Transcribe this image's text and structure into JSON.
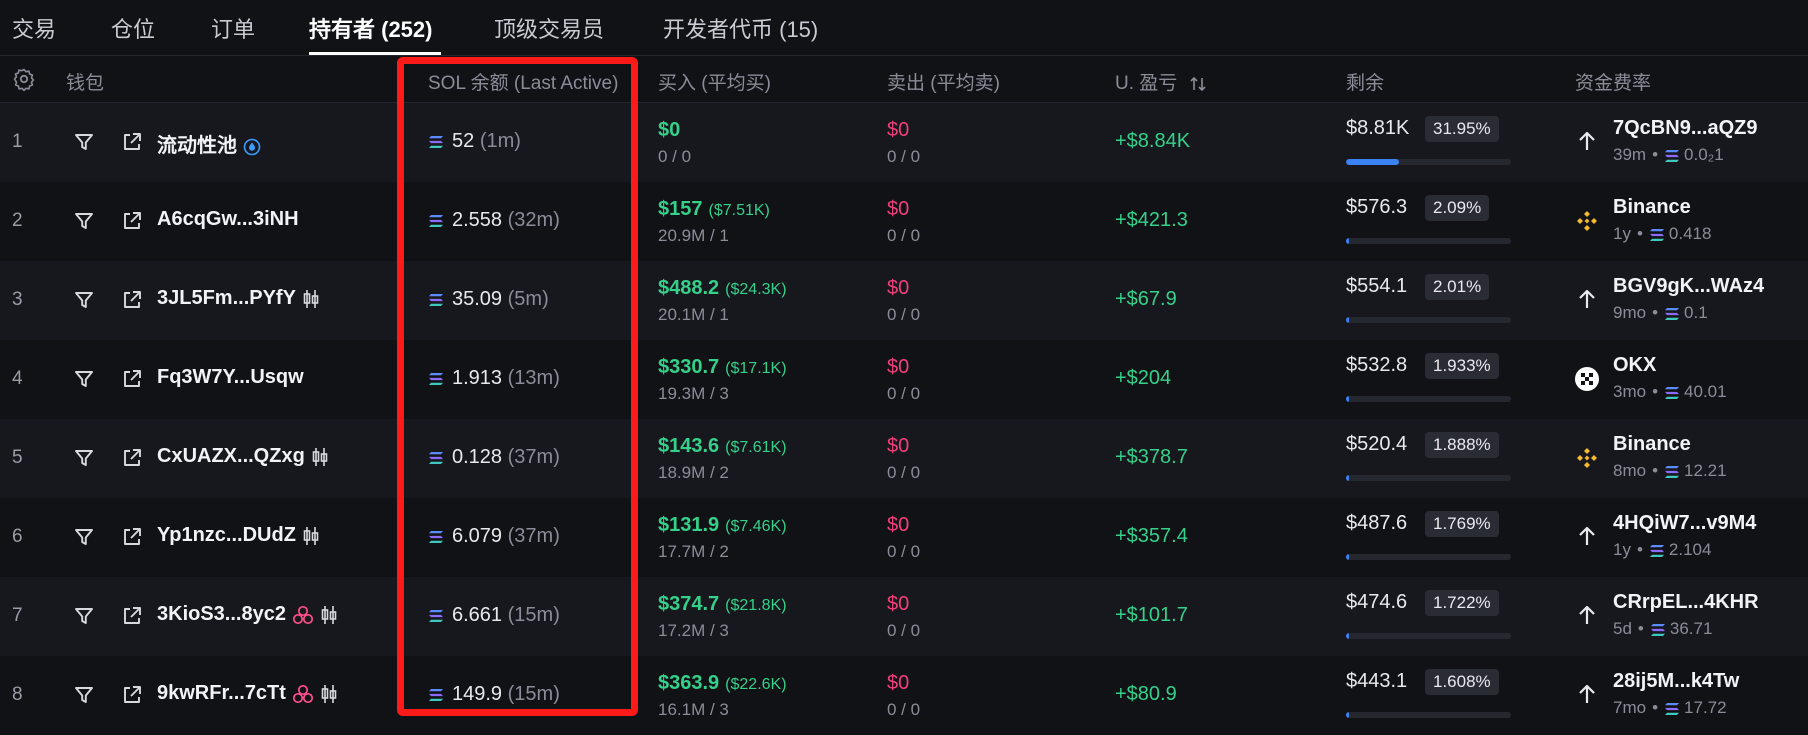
{
  "tabs": [
    "交易",
    "仓位",
    "订单",
    "持有者 (252)",
    "顶级交易员",
    "开发者代币 (15)"
  ],
  "active_tab_index": 3,
  "columns": {
    "wallet": "钱包",
    "sol_balance": "SOL 余额 (Last Active)",
    "buy": "买入 (平均买)",
    "sell": "卖出 (平均卖)",
    "pnl": "U. 盈亏",
    "remaining": "剩余",
    "funding": "资金费率"
  },
  "icons": {
    "settings": "gear-icon",
    "filter": "filter-icon",
    "external": "external-link-icon",
    "sol": "solana-icon",
    "sort": "sort-icon",
    "arrow_up": "arrow-up-icon",
    "binance": "binance-icon",
    "okx": "okx-icon"
  },
  "colors": {
    "positive": "#35d08a",
    "negative": "#f0407a",
    "accent_bar": "#3b82f6",
    "highlight": "#ff1a1a"
  },
  "rows": [
    {
      "index": "1",
      "wallet": "流动性池",
      "tags": [
        "pool"
      ],
      "sol": "52",
      "last_active": "(1m)",
      "buy": "$0",
      "buy_avg": "",
      "buy_sub": "0 / 0",
      "sell": "$0",
      "sell_sub": "0 / 0",
      "pnl": "+$8.84K",
      "remaining": "$8.81K",
      "pct": "31.95%",
      "pct_value": 0.3195,
      "fund_icon": "arrow-up",
      "fund_name": "7QcBN9...aQZ9",
      "fund_age": "39m",
      "fund_sol": "0.0₂1"
    },
    {
      "index": "2",
      "wallet": "A6cqGw...3iNH",
      "tags": [],
      "sol": "2.558",
      "last_active": "(32m)",
      "buy": "$157",
      "buy_avg": "($7.51K)",
      "buy_sub": "20.9M / 1",
      "sell": "$0",
      "sell_sub": "0 / 0",
      "pnl": "+$421.3",
      "remaining": "$576.3",
      "pct": "2.09%",
      "pct_value": 0.0209,
      "fund_icon": "binance",
      "fund_name": "Binance",
      "fund_age": "1y",
      "fund_sol": "0.418"
    },
    {
      "index": "3",
      "wallet": "3JL5Fm...PYfY",
      "tags": [
        "candle"
      ],
      "sol": "35.09",
      "last_active": "(5m)",
      "buy": "$488.2",
      "buy_avg": "($24.3K)",
      "buy_sub": "20.1M / 1",
      "sell": "$0",
      "sell_sub": "0 / 0",
      "pnl": "+$67.9",
      "remaining": "$554.1",
      "pct": "2.01%",
      "pct_value": 0.0201,
      "fund_icon": "arrow-up",
      "fund_name": "BGV9gK...WAz4",
      "fund_age": "9mo",
      "fund_sol": "0.1"
    },
    {
      "index": "4",
      "wallet": "Fq3W7Y...Usqw",
      "tags": [],
      "sol": "1.913",
      "last_active": "(13m)",
      "buy": "$330.7",
      "buy_avg": "($17.1K)",
      "buy_sub": "19.3M / 3",
      "sell": "$0",
      "sell_sub": "0 / 0",
      "pnl": "+$204",
      "remaining": "$532.8",
      "pct": "1.933%",
      "pct_value": 0.01933,
      "fund_icon": "okx",
      "fund_name": "OKX",
      "fund_age": "3mo",
      "fund_sol": "40.01"
    },
    {
      "index": "5",
      "wallet": "CxUAZX...QZxg",
      "tags": [
        "candle"
      ],
      "sol": "0.128",
      "last_active": "(37m)",
      "buy": "$143.6",
      "buy_avg": "($7.61K)",
      "buy_sub": "18.9M / 2",
      "sell": "$0",
      "sell_sub": "0 / 0",
      "pnl": "+$378.7",
      "remaining": "$520.4",
      "pct": "1.888%",
      "pct_value": 0.01888,
      "fund_icon": "binance",
      "fund_name": "Binance",
      "fund_age": "8mo",
      "fund_sol": "12.21"
    },
    {
      "index": "6",
      "wallet": "Yp1nzc...DUdZ",
      "tags": [
        "candle"
      ],
      "sol": "6.079",
      "last_active": "(37m)",
      "buy": "$131.9",
      "buy_avg": "($7.46K)",
      "buy_sub": "17.7M / 2",
      "sell": "$0",
      "sell_sub": "0 / 0",
      "pnl": "+$357.4",
      "remaining": "$487.6",
      "pct": "1.769%",
      "pct_value": 0.01769,
      "fund_icon": "arrow-up",
      "fund_name": "4HQiW7...v9M4",
      "fund_age": "1y",
      "fund_sol": "2.104"
    },
    {
      "index": "7",
      "wallet": "3KioS3...8yc2",
      "tags": [
        "bundle",
        "candle"
      ],
      "sol": "6.661",
      "last_active": "(15m)",
      "buy": "$374.7",
      "buy_avg": "($21.8K)",
      "buy_sub": "17.2M / 3",
      "sell": "$0",
      "sell_sub": "0 / 0",
      "pnl": "+$101.7",
      "remaining": "$474.6",
      "pct": "1.722%",
      "pct_value": 0.01722,
      "fund_icon": "arrow-up",
      "fund_name": "CRrpEL...4KHR",
      "fund_age": "5d",
      "fund_sol": "36.71"
    },
    {
      "index": "8",
      "wallet": "9kwRFr...7cTt",
      "tags": [
        "bundle",
        "candle"
      ],
      "sol": "149.9",
      "last_active": "(15m)",
      "buy": "$363.9",
      "buy_avg": "($22.6K)",
      "buy_sub": "16.1M / 3",
      "sell": "$0",
      "sell_sub": "0 / 0",
      "pnl": "+$80.9",
      "remaining": "$443.1",
      "pct": "1.608%",
      "pct_value": 0.01608,
      "fund_icon": "arrow-up",
      "fund_name": "28ij5M...k4Tw",
      "fund_age": "7mo",
      "fund_sol": "17.72"
    }
  ]
}
